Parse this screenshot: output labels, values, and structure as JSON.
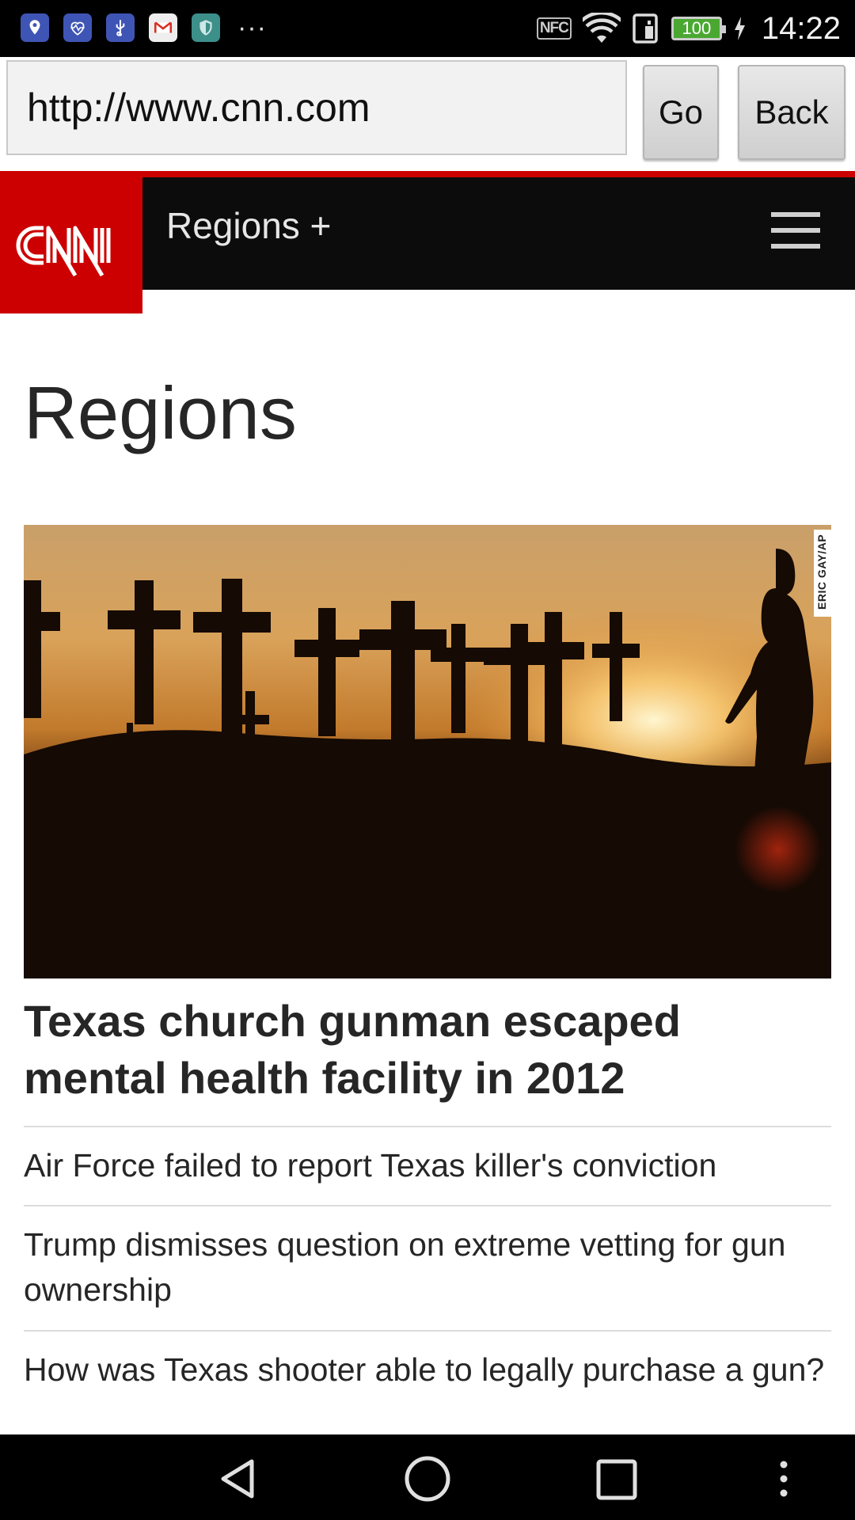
{
  "status_bar": {
    "notification_icons": [
      "location-icon",
      "health-icon",
      "usb-icon",
      "gmail-icon",
      "shield-icon"
    ],
    "more": "···",
    "nfc": "NFC",
    "battery": "100",
    "time": "14:22"
  },
  "browser": {
    "url": "http://www.cnn.com",
    "go_label": "Go",
    "back_label": "Back"
  },
  "site": {
    "logo": "CNN",
    "nav_label": "Regions +",
    "colors": {
      "brand": "#cc0000",
      "header": "#0c0c0c"
    }
  },
  "page": {
    "title": "Regions",
    "hero_credit": "ERIC GAY/AP",
    "headline": "Texas church gunman escaped mental health facility in 2012",
    "related": [
      "Air Force failed to report Texas killer's conviction",
      "Trump dismisses question on extreme vetting for gun ownership",
      "How was Texas shooter able to legally purchase a gun?"
    ]
  },
  "nav_bar": {
    "buttons": [
      "back-triangle-icon",
      "home-circle-icon",
      "recents-square-icon",
      "overflow-menu-icon"
    ]
  }
}
